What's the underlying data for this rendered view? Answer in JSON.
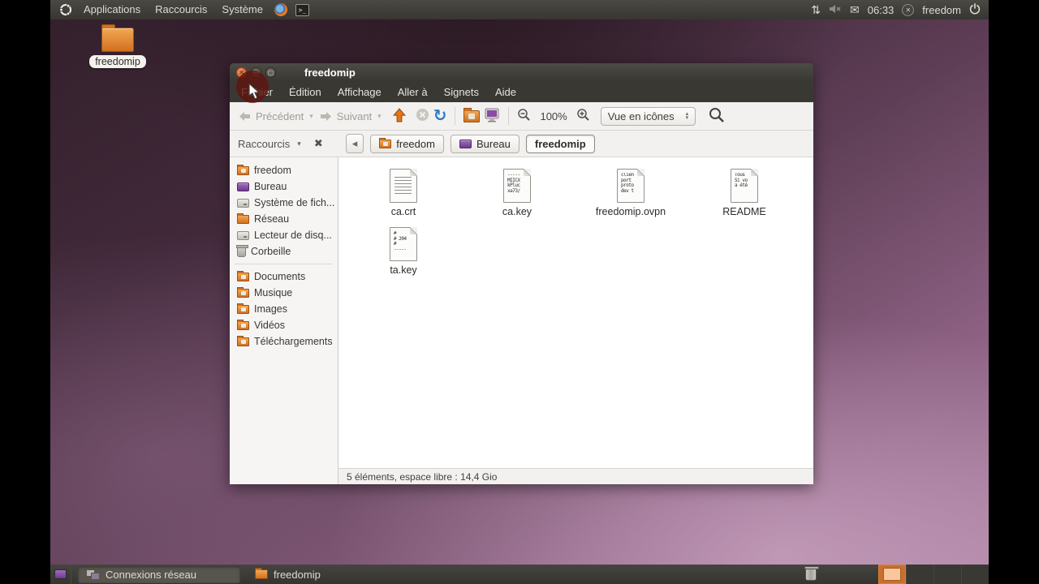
{
  "top_panel": {
    "menus": [
      "Applications",
      "Raccourcis",
      "Système"
    ],
    "clock": "06:33",
    "user": "freedom"
  },
  "desktop_icon": {
    "label": "freedomip"
  },
  "window": {
    "title": "freedomip",
    "menubar": [
      "Fichier",
      "Édition",
      "Affichage",
      "Aller à",
      "Signets",
      "Aide"
    ],
    "toolbar": {
      "back": "Précédent",
      "forward": "Suivant",
      "zoom_level": "100%",
      "view_mode": "Vue en icônes"
    },
    "location": {
      "shortcuts_label": "Raccourcis",
      "crumbs": [
        "freedom",
        "Bureau",
        "freedomip"
      ]
    },
    "sidebar": [
      {
        "label": "freedom"
      },
      {
        "label": "Bureau"
      },
      {
        "label": "Système de fich..."
      },
      {
        "label": "Réseau"
      },
      {
        "label": "Lecteur de disq..."
      },
      {
        "label": "Corbeille"
      },
      {
        "label": "Documents"
      },
      {
        "label": "Musique"
      },
      {
        "label": "Images"
      },
      {
        "label": "Vidéos"
      },
      {
        "label": "Téléchargements"
      }
    ],
    "files": [
      {
        "name": "ca.crt",
        "preview": null
      },
      {
        "name": "ca.key",
        "preview": "-----\nMIICX\nkPluc\nxa73/"
      },
      {
        "name": "freedomip.ovpn",
        "preview": "clien\nport\nproto\ndev t"
      },
      {
        "name": "README",
        "preview": "Tous\nSi vo\na été"
      },
      {
        "name": "ta.key",
        "preview": "#\n# 204\n#\n-----"
      }
    ],
    "status": "5 éléments, espace libre : 14,4 Gio"
  },
  "bottom_panel": {
    "tasks": [
      {
        "label": "Connexions réseau"
      },
      {
        "label": "freedomip"
      }
    ],
    "workspace_count": 4
  }
}
